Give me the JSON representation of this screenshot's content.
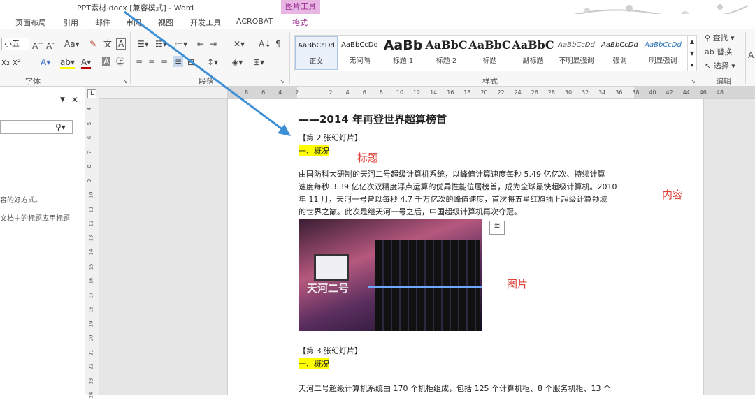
{
  "titlebar": {
    "title": "PPT素材.docx [兼容模式] - Word",
    "context_tab": "图片工具"
  },
  "tabs": [
    "页面布局",
    "引用",
    "邮件",
    "审阅",
    "视图",
    "开发工具",
    "ACROBAT",
    "格式"
  ],
  "ribbon": {
    "font_size": "小五",
    "group_font": "字体",
    "group_paragraph": "段落",
    "group_styles": "样式",
    "group_edit": "编辑",
    "styles": [
      {
        "preview": "AaBbCcDd",
        "name": "正文"
      },
      {
        "preview": "AaBbCcDd",
        "name": "无间隔"
      },
      {
        "preview": "AaBb",
        "name": "标题 1"
      },
      {
        "preview": "AaBbC",
        "name": "标题 2"
      },
      {
        "preview": "AaBbC",
        "name": "标题"
      },
      {
        "preview": "AaBbC",
        "name": "副标题"
      },
      {
        "preview": "AaBbCcDd",
        "name": "不明显强调"
      },
      {
        "preview": "AaBbCcDd",
        "name": "强调"
      },
      {
        "preview": "AaBbCcDd",
        "name": "明显强调"
      }
    ],
    "find": "查找",
    "replace": "替换",
    "select": "选择"
  },
  "nav_pane": {
    "text1": "容的好方式。",
    "text2": "文档中的标题应用标题"
  },
  "hruler_ticks": [
    "8",
    "6",
    "4",
    "2",
    "",
    "2",
    "4",
    "6",
    "8",
    "10",
    "12",
    "14",
    "16",
    "18",
    "20",
    "22",
    "24",
    "26",
    "28",
    "30",
    "32",
    "34",
    "36",
    "38",
    "40",
    "42",
    "44",
    "46",
    "48"
  ],
  "vruler_ticks": [
    "4",
    "5",
    "6",
    "7",
    "8",
    "9",
    "10",
    "11",
    "12",
    "13",
    "14",
    "15",
    "16",
    "17",
    "18",
    "19",
    "20",
    "21",
    "22",
    "23",
    "24"
  ],
  "document": {
    "title": "——2014 年再登世界超算榜首",
    "slide2": "【第 2 张幻灯片】",
    "heading1": "一、概况",
    "para_lines": [
      "由国防科大研制的天河二号超级计算机系统，以峰值计算速度每秒 5.49 亿亿次、持续计算",
      "速度每秒 3.39 亿亿次双精度浮点运算的优异性能位居榜首，成为全球最快超级计算机。2010",
      "年 11 月，天河一号曾以每秒 4.7 千万亿次的峰值速度，首次将五星红旗插上超级计算领域",
      "的世界之巅。此次是继天河一号之后，中国超级计算机再次夺冠。"
    ],
    "image_text": "天河二号",
    "slide3": "【第 3 张幻灯片】",
    "heading2": "一、概况",
    "para2": "天河二号超级计算机系统由 170 个机柜组成，包括 125 个计算机柜、8 个服务机柜、13 个"
  },
  "annotations": {
    "title_label": "标题",
    "content_label": "内容",
    "image_label": "图片"
  },
  "colors": {
    "accent": "#2b579a",
    "context_tab": "#e7b6e3",
    "annotation": "#e0403a",
    "arrow": "#3d8fd6",
    "highlight": "#ffff00"
  }
}
